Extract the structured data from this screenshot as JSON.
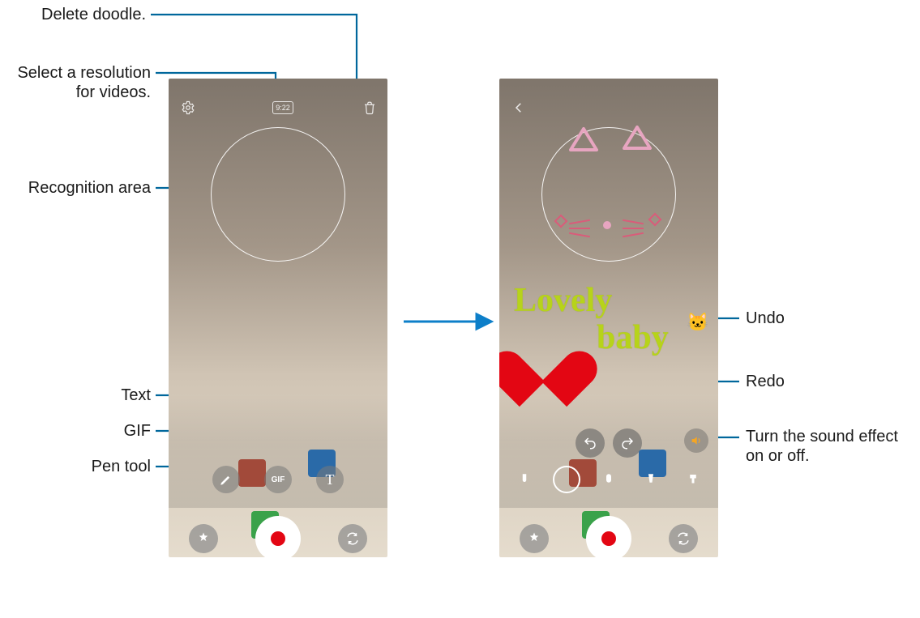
{
  "callouts": {
    "delete_doodle": "Delete doodle.",
    "select_resolution": "Select a resolution for videos.",
    "recognition_area": "Recognition area",
    "text_tool": "Text",
    "gif_tool": "GIF",
    "pen_tool": "Pen tool",
    "undo": "Undo",
    "redo": "Redo",
    "sound_toggle": "Turn the sound effect on or off."
  },
  "left_phone": {
    "icons": {
      "settings": "settings-gear",
      "resolution": "9:22",
      "delete": "trash"
    },
    "tools": [
      "pen",
      "gif",
      "text"
    ],
    "bottom": [
      "effects",
      "record",
      "switch-camera"
    ]
  },
  "right_phone": {
    "icons": {
      "back": "back-chevron"
    },
    "overlay": {
      "line1": "Lovely",
      "line2": "baby",
      "stamp": "🐱"
    },
    "controls": {
      "undo": "undo",
      "redo": "redo",
      "sound": "speaker"
    },
    "brush_row": [
      "eraser",
      "hatch",
      "round",
      "marker",
      "flat"
    ],
    "bottom": [
      "effects",
      "record",
      "switch-camera"
    ]
  },
  "colors": {
    "leader": "#00679c",
    "arrow": "#0d7fc9",
    "doodle_text": "#b7d31a",
    "heart": "#e30613"
  }
}
